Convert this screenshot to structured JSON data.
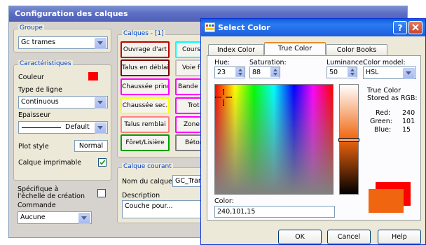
{
  "main": {
    "title": "Configuration des calques",
    "groupe": {
      "label": "Groupe",
      "value": "Gc trames"
    },
    "caract": {
      "label": "Caractéristiques",
      "couleur_label": "Couleur",
      "couleur_color": "#ff0000",
      "linetype_label": "Type de ligne",
      "linetype_value": "Continuous",
      "thickness_label": "Epaisseur",
      "thickness_value": "Default",
      "plotstyle_label": "Plot style",
      "plotstyle_value": "Normal",
      "printable_label": "Calque imprimable",
      "scale_label": "Spécifique à l'échelle de création",
      "command_label": "Commande",
      "command_value": "Aucune"
    },
    "layers": {
      "label": "Calques - [1]",
      "col1": [
        {
          "label": "Ouvrage d'art",
          "color": "#c00000"
        },
        {
          "label": "Talus en déblai",
          "color": "#800000"
        },
        {
          "label": "Chaussée princ.",
          "color": "#ff00ff"
        },
        {
          "label": "Chaussée sec.",
          "color": "#ffff00"
        },
        {
          "label": "Talus remblai",
          "color": "#ff8080"
        },
        {
          "label": "Fôret/Lisière",
          "color": "#00a000"
        }
      ],
      "col2": [
        {
          "label": "Cours",
          "color": "#00ffff"
        },
        {
          "label": "Voie f",
          "color": "#c0c0c0"
        },
        {
          "label": "Bande d",
          "color": "#ff00ff"
        },
        {
          "label": "Trot",
          "color": "#ff00ff"
        },
        {
          "label": "Zone",
          "color": "#ff00ff"
        },
        {
          "label": "Béton",
          "color": "#808080"
        }
      ]
    },
    "current": {
      "label": "Calque courant",
      "name_label": "Nom du calque",
      "name_value": "GC_Tram",
      "desc_label": "Description",
      "desc_value": "Couche pour..."
    }
  },
  "dialog": {
    "title": "Select Color",
    "tabs": [
      "Index Color",
      "True Color",
      "Color Books"
    ],
    "hue_label": "Hue:",
    "hue_value": "23",
    "sat_label": "Saturation:",
    "sat_value": "88",
    "lum_label": "Luminance:",
    "lum_value": "50",
    "model_label": "Color model:",
    "model_value": "HSL",
    "stored_label": "True Color Stored as RGB:",
    "red_label": "Red:",
    "red_value": "240",
    "green_label": "Green:",
    "green_value": "101",
    "blue_label": "Blue:",
    "blue_value": "15",
    "color_label": "Color:",
    "color_value": "240,101,15",
    "old_color": "#ff0000",
    "new_color": "#f0650f",
    "ok": "OK",
    "cancel": "Cancel",
    "help": "Help"
  }
}
